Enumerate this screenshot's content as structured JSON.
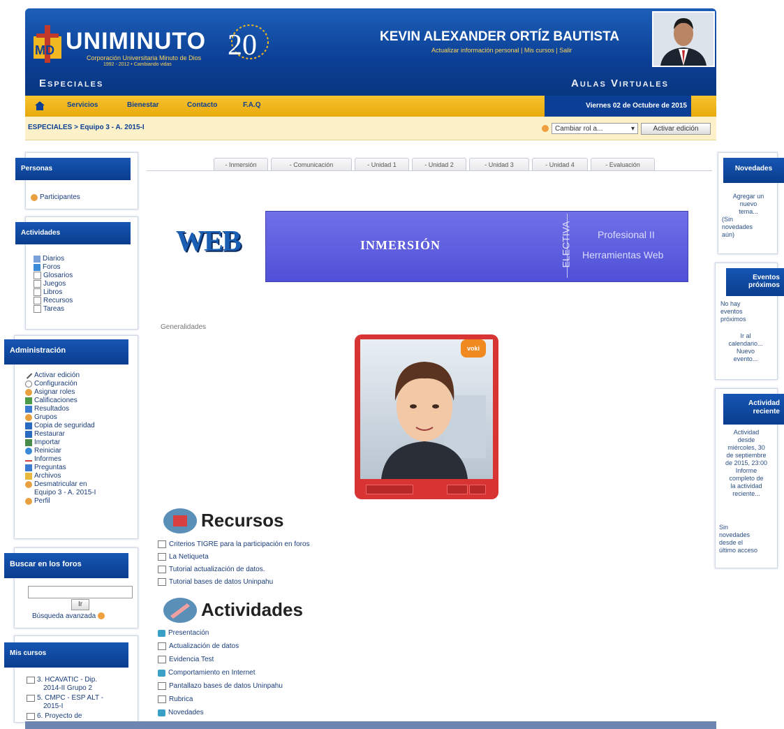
{
  "header": {
    "logo_text": "UNIMINUTO",
    "logo_sub": "Corporación Universitaria Minuto de Dios",
    "logo_sub2": "1992 - 2012  •  Cambiando vidas",
    "logo_badge": "20",
    "user_name": "KEVIN ALEXANDER ORTÍZ BAUTISTA",
    "user_links": [
      "Actualizar información personal",
      "Mis cursos",
      "Salir"
    ],
    "left_label": "Especiales",
    "right_label": "Aulas Virtuales"
  },
  "nav": {
    "items": [
      "Servicios",
      "Bienestar",
      "Contacto",
      "F.A.Q"
    ],
    "date": "Viernes 02 de Octubre de 2015"
  },
  "breadcrumb": "ESPECIALES > Equipo 3 - A. 2015-I",
  "role_select": "Cambiar rol a...",
  "activar_edicion": "Activar edición",
  "tabs": [
    "- Inmersión",
    "- Comunicación",
    "- Unidad 1",
    "- Unidad 2",
    "- Unidad 3",
    "- Unidad 4",
    "- Evaluación"
  ],
  "left": {
    "personas": {
      "title": "Personas",
      "items": [
        "Participantes"
      ]
    },
    "actividades": {
      "title": "Actividades",
      "items": [
        "Diarios",
        "Foros",
        "Glosarios",
        "Juegos",
        "Libros",
        "Recursos",
        "Tareas"
      ]
    },
    "administracion": {
      "title": "Administración",
      "items": [
        "Activar edición",
        "Configuración",
        "Asignar roles",
        "Calificaciones",
        "Resultados",
        "Grupos",
        "Copia de seguridad",
        "Restaurar",
        "Importar",
        "Reiniciar",
        "Informes",
        "Preguntas",
        "Archivos",
        "Desmatricular en",
        "Equipo 3 - A. 2015-I",
        "Perfil"
      ]
    },
    "buscar": {
      "title": "Buscar en los foros",
      "button": "Ir",
      "advanced": "Búsqueda avanzada"
    },
    "mis_cursos": {
      "title": "Mis cursos",
      "items": [
        "3. HCAVATIC - Dip.",
        "2014-II Grupo 2",
        "5. CMPC - ESP ALT -",
        "2015-I",
        "6. Proyecto de"
      ]
    }
  },
  "right": {
    "novedades": {
      "title": "Novedades",
      "text": [
        "Agregar un",
        "nuevo",
        "tema...",
        "(Sin",
        "novedades",
        "aún)"
      ]
    },
    "eventos": {
      "title": "Eventos próximos",
      "text": [
        "No hay",
        "eventos",
        "próximos",
        "Ir al",
        "calendario...",
        "Nuevo",
        "evento..."
      ]
    },
    "reciente": {
      "title": "Actividad reciente",
      "text": [
        "Actividad",
        "desde",
        "miércoles, 30",
        "de septiembre",
        "de 2015, 23:00",
        "Informe",
        "completo de",
        "la actividad",
        "reciente...",
        "Sin",
        "novedades",
        "desde el",
        "último acceso"
      ]
    }
  },
  "banner": {
    "web": "WEB",
    "title": "INMERSIÓN",
    "vertical": "ELECTIVA",
    "line1": "Profesional II",
    "line2": "Herramientas Web"
  },
  "generalidades": "Generalidades",
  "video_badge": "voki",
  "recursos": {
    "title": "Recursos",
    "items": [
      "Criterios TIGRE para la participación en foros",
      "La Netiqueta",
      "Tutorial actualización de datos.",
      "Tutorial bases de datos Uninpahu"
    ]
  },
  "actividades_section": {
    "title": "Actividades",
    "items": [
      "Presentación",
      "Actualización de datos",
      "Evidencia Test",
      "Comportamiento en Internet",
      "Pantallazo bases de datos Uninpahu",
      "Rubrica",
      "Novedades"
    ]
  },
  "colors": {
    "brand_blue": "#0b3f95",
    "brand_yellow": "#f2b81f"
  }
}
